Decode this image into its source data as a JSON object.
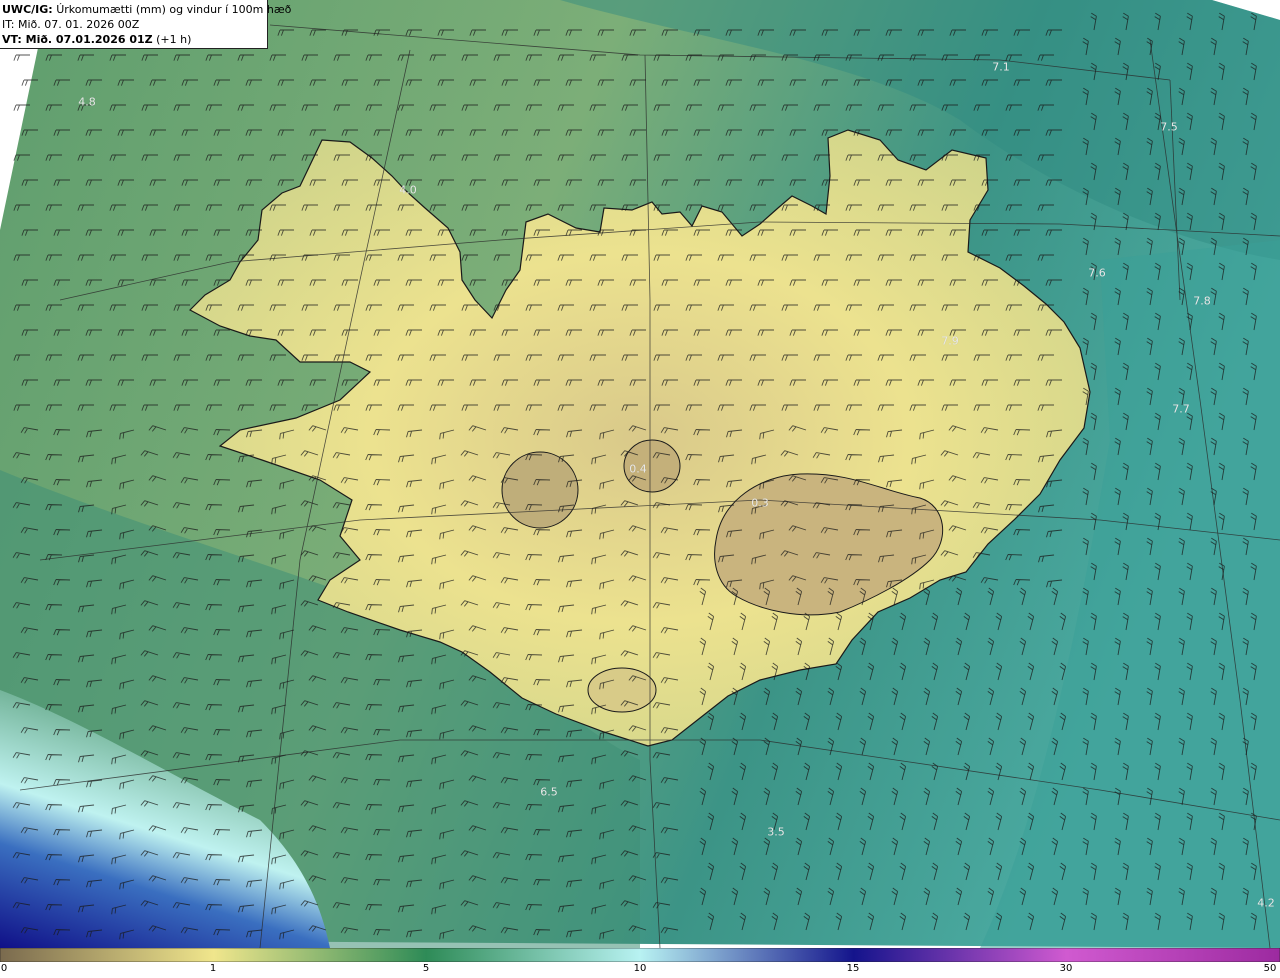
{
  "header": {
    "model_label": "UWC/IG:",
    "title": "Úrkomumætti (mm) og vindur í 100m hæð",
    "issue_time": "IT: Mið. 07. 01. 2026 00Z",
    "valid_label": "VT: Mið. 07.01.2026 01Z",
    "valid_offset": "(+1 h)"
  },
  "value_labels": [
    "4.8",
    "4.0",
    "7.1",
    "7.5",
    "7.6",
    "7.8",
    "7.9",
    "7.7",
    "0.4",
    "0.3",
    "6.5",
    "3.5",
    "4.2"
  ],
  "colorbar": {
    "ticks": [
      "0",
      "1",
      "5",
      "10",
      "15",
      "30",
      "50"
    ],
    "colors": [
      "#7a6a4e",
      "#f0e68c",
      "#2e8b57",
      "#b8f2f2",
      "#14148c",
      "#d05ad0",
      "#9c2aa0"
    ]
  },
  "colors": {
    "land": "#e6df8e",
    "sea_near": "#6fa87a",
    "sea_far": "#3d9a8e",
    "coastline": "#1a1a1a",
    "grid": "#2a2a2a",
    "barb": "#1a1a1a"
  }
}
